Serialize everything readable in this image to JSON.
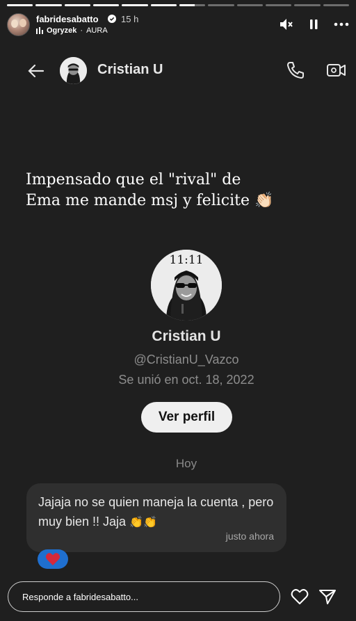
{
  "story": {
    "progress": [
      1,
      1,
      1,
      1,
      1,
      1,
      0.6,
      0,
      0,
      0,
      0,
      0
    ],
    "username": "fabridesabatto",
    "time": "15 h",
    "music_artist": "Ogryzek",
    "music_song": "AURA",
    "music_separator": "·",
    "icons": [
      "mute-icon",
      "pause-icon",
      "more-icon"
    ]
  },
  "dm": {
    "name": "Cristian U",
    "icons": [
      "back-arrow-icon",
      "phone-icon",
      "video-call-icon"
    ]
  },
  "overlay": {
    "line1": "Impensado que el \"rival\" de",
    "line2": "Ema me mande msj y felicite",
    "emoji": "👏🏻"
  },
  "profile": {
    "avatar_text": "11:11",
    "name": "Cristian U",
    "handle": "@CristianU_Vazco",
    "joined": "Se unió en oct. 18, 2022",
    "button_label": "Ver perfil"
  },
  "conversation": {
    "day_label": "Hoy",
    "message_text": "Jajaja no se quien maneja la cuenta , pero muy bien !! Jaja",
    "message_emoji": "👏👏",
    "message_time": "justo ahora",
    "reaction": "❤️"
  },
  "reply": {
    "placeholder": "Responde a fabridesabatto..."
  },
  "colors": {
    "background": "#1f1f1f",
    "bubble": "#2f2f2f",
    "reaction": "#1f6fcf",
    "heart": "#d6283b"
  }
}
